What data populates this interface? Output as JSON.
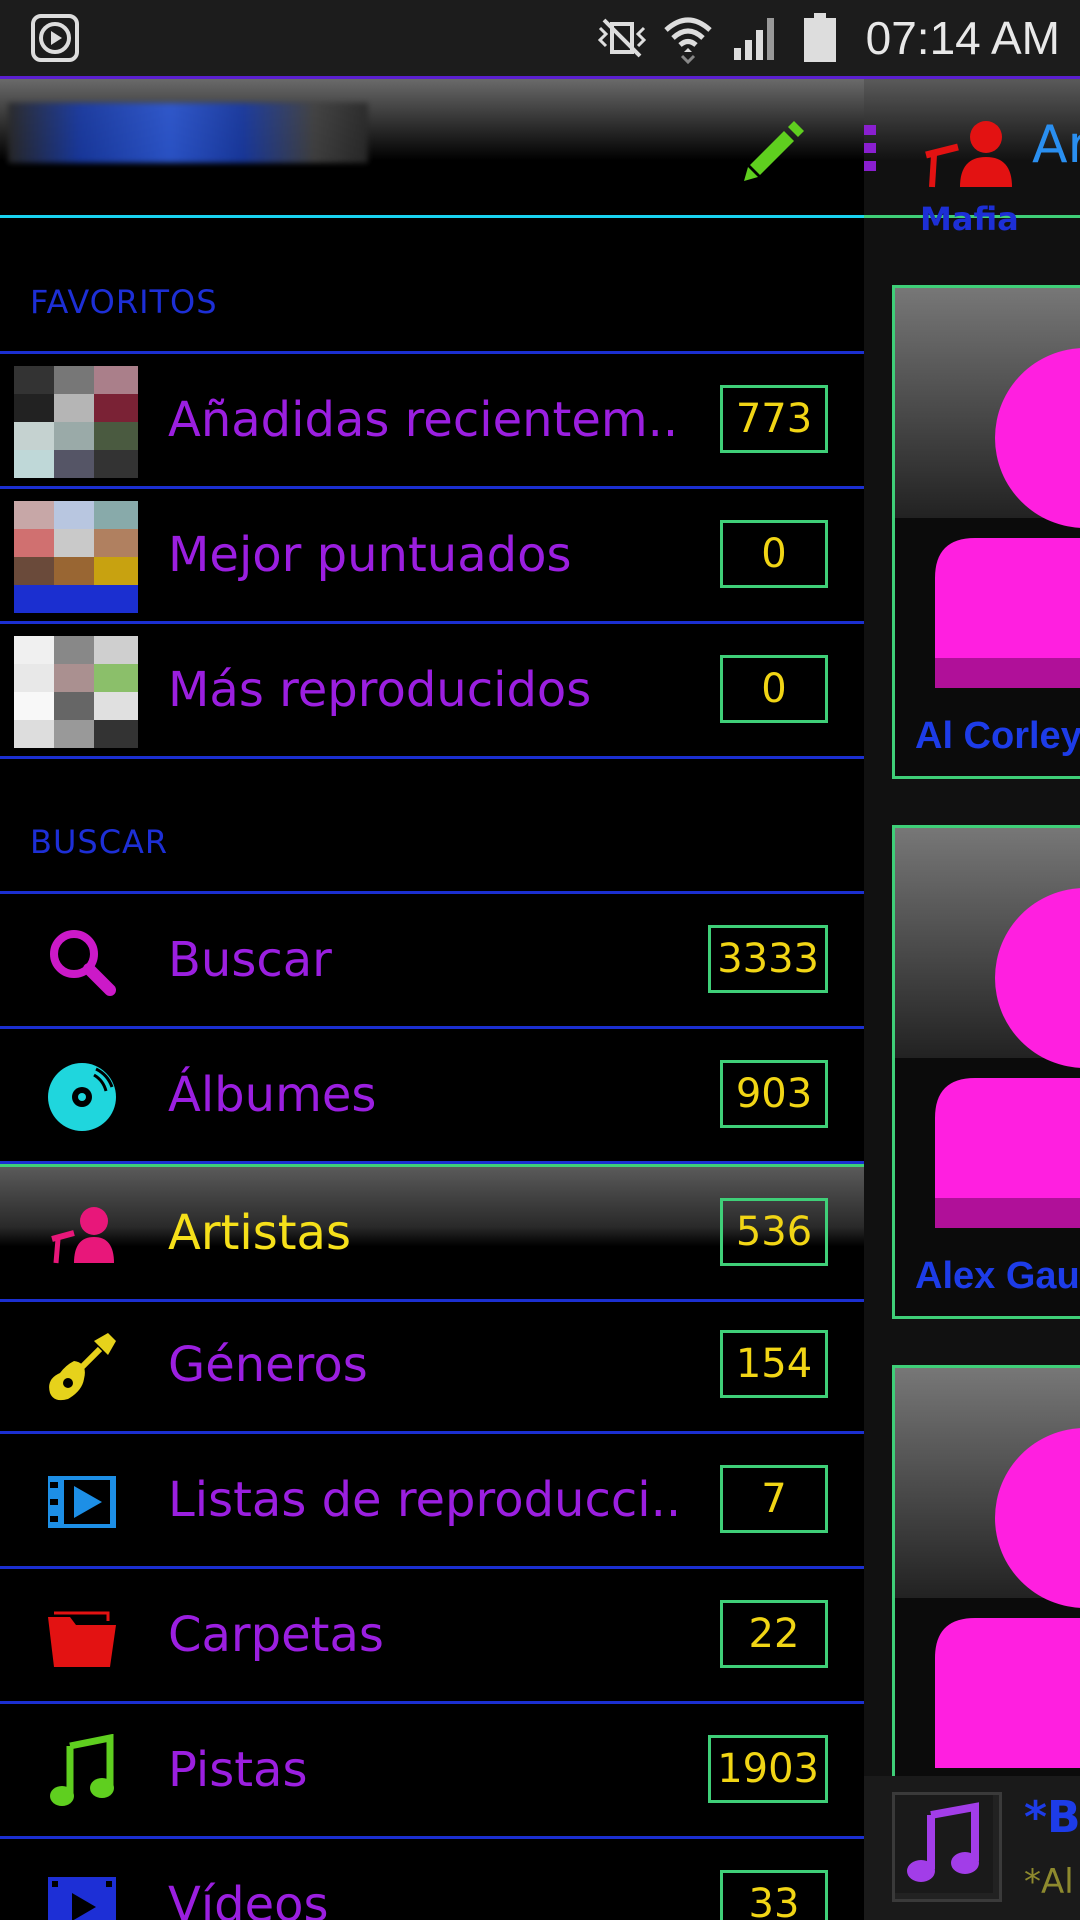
{
  "status_bar": {
    "time": "07:14 AM",
    "icons": [
      "media-icon",
      "mute-vibrate-icon",
      "wifi-icon",
      "signal-icon",
      "battery-icon"
    ]
  },
  "drawer": {
    "header": {
      "edit_icon": "pencil-icon"
    },
    "favorites": {
      "label": "FAVORITOS",
      "items": [
        {
          "label": "Añadidas recientem..",
          "count": "773"
        },
        {
          "label": "Mejor puntuados",
          "count": "0"
        },
        {
          "label": "Más reproducidos",
          "count": "0"
        }
      ]
    },
    "browse": {
      "label": "BUSCAR",
      "items": [
        {
          "label": "Buscar",
          "count": "3333",
          "icon": "search-icon",
          "color": "#cc19c8"
        },
        {
          "label": "Álbumes",
          "count": "903",
          "icon": "disc-icon",
          "color": "#1fd6dd"
        },
        {
          "label": "Artistas",
          "count": "536",
          "icon": "artist-icon",
          "color": "#e8177a",
          "selected": true
        },
        {
          "label": "Géneros",
          "count": "154",
          "icon": "guitar-icon",
          "color": "#e6d21b"
        },
        {
          "label": "Listas de reproducci..",
          "count": "7",
          "icon": "playlist-icon",
          "color": "#1d8fe6"
        },
        {
          "label": "Carpetas",
          "count": "22",
          "icon": "folder-icon",
          "color": "#e31212"
        },
        {
          "label": "Pistas",
          "count": "1903",
          "icon": "music-note-icon",
          "color": "#5fcf1f"
        },
        {
          "label": "Vídeos",
          "count": "33",
          "icon": "video-icon",
          "color": "#1d2fd6"
        }
      ]
    }
  },
  "panel": {
    "title": "Ar",
    "subtitle": "Mafia",
    "cards": [
      {
        "name": "Al Corley"
      },
      {
        "name": "Alex Gau"
      },
      {
        "name": ""
      }
    ],
    "now_playing": {
      "title": "*B",
      "subtitle": "*Al"
    }
  },
  "colors": {
    "accent_purple": "#9b1fe0",
    "divider_blue": "#1b2fd0",
    "count_border": "#3fcf78",
    "count_text": "#f1d515",
    "selected_text": "#f6e01a"
  }
}
